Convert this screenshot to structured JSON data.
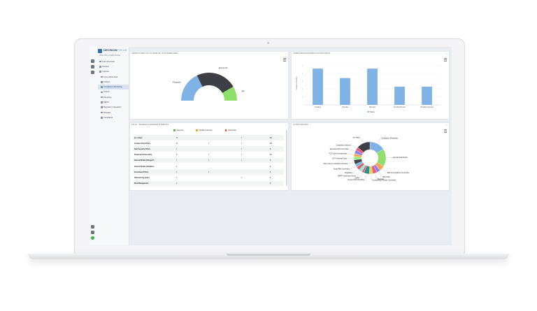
{
  "brand": {
    "name_a": "DECISION",
    "name_b": "FOCUS",
    "subtitle": "RISK AND COMPLIANCE"
  },
  "sidebar": {
    "items": [
      {
        "label": "Team Overview",
        "active": false,
        "sub": false
      },
      {
        "label": "Decision",
        "active": false,
        "sub": false
      },
      {
        "label": "Contract",
        "active": false,
        "sub": false
      },
      {
        "label": "Group Wide Data",
        "active": false,
        "sub": true
      },
      {
        "label": "Policies",
        "active": false,
        "sub": true
      },
      {
        "label": "Compliance Monitoring",
        "active": true,
        "sub": true
      },
      {
        "label": "Actions",
        "active": false,
        "sub": true
      },
      {
        "label": "Reporting",
        "active": false,
        "sub": true
      },
      {
        "label": "MBOS",
        "active": false,
        "sub": true
      },
      {
        "label": "Regulatory Interaction",
        "active": false,
        "sub": true
      },
      {
        "label": "Disputes",
        "active": false,
        "sub": true
      },
      {
        "label": "Complaints",
        "active": false,
        "sub": true
      }
    ]
  },
  "panels": {
    "gauge_title": "CONDUCT RISKS OUT OF APPETITE - BY BUSINESS AREA",
    "bar_title": "COMPLIANCE MONITORING ACTIONS STATUS",
    "table_title": "POLICY - BUSINESS STANDARDS ATTRIBUTES",
    "donut_title": "ACTION TRACKING"
  },
  "chart_data": [
    {
      "type": "pie",
      "subtype": "half-donut",
      "labels": [
        "Financial",
        "Economic",
        "HR"
      ],
      "values": [
        3,
        4,
        1.4
      ],
      "colors": [
        "#7fb2e5",
        "#3d3f45",
        "#8ee06b"
      ]
    },
    {
      "type": "bar",
      "categories": [
        "Pending",
        "Overdue",
        "Planning",
        "Pending Review",
        "Pending Approval"
      ],
      "values": [
        4.6,
        3.4,
        4.6,
        2.3,
        2.3
      ],
      "ylabel": "Number of Actions",
      "legend": "Status",
      "color": "#7fb2e5",
      "ylim": [
        0,
        5.5
      ]
    },
    {
      "type": "pie",
      "subtype": "donut",
      "labels": [
        "Compliance Monitoring",
        "Internal Audit Report",
        "Risk & Compliance Committee",
        "Risk Team",
        "Business",
        "Counterparty Security Committee",
        "Group Audit Committee",
        "GDPR",
        "GDPR Governance forum",
        "Regulatory",
        "Group Risk Committee",
        "Client money oversight committee",
        "SGT Steering Group",
        "FCA Client Questionnaire",
        "Executive Risk Committee",
        "Compliance Advisory",
        "(no value)"
      ],
      "values": [
        14,
        16,
        5,
        3,
        4,
        3,
        5,
        2,
        3,
        3,
        3,
        4,
        3,
        3,
        3,
        3,
        12
      ],
      "colors": [
        "#7fb2e5",
        "#8ee06b",
        "#f7a35c",
        "#8085e9",
        "#f15c80",
        "#e4d354",
        "#2b908f",
        "#f45b5b",
        "#91e8e1",
        "#e45d5d",
        "#7cb5ec",
        "#434348",
        "#90ed7d",
        "#f7a35c",
        "#8085e9",
        "#f15c80",
        "#3d3f45"
      ]
    }
  ],
  "table": {
    "legend": [
      "Adequate",
      "Partially Adequate",
      "Inadequate"
    ],
    "legend_colors": [
      "#5fb84c",
      "#f4a940",
      "#e0523a"
    ],
    "rows": [
      {
        "name": "(no value)",
        "a": "11",
        "p": "",
        "i": "1",
        "t": "12"
      },
      {
        "name": "Conduct Risk Policy",
        "a": "11",
        "p": "1",
        "i": "1",
        "t": "13"
      },
      {
        "name": "Data Security Policy",
        "a": "1",
        "p": "",
        "i": "1",
        "t": "2"
      },
      {
        "name": "Financial Crime policy",
        "a": "9",
        "p": "1",
        "i": "1",
        "t": "11"
      },
      {
        "name": "Internal Model Change P...",
        "a": "1",
        "p": "1",
        "i": "1",
        "t": "3"
      },
      {
        "name": "Internal Model Validation",
        "a": "2",
        "p": "",
        "i": "",
        "t": "2"
      },
      {
        "name": "Investment Policy",
        "a": "1",
        "p": "1",
        "i": "",
        "t": "2"
      },
      {
        "name": "Outsourcing policy",
        "a": "1",
        "p": "",
        "i": "1",
        "t": "2"
      },
      {
        "name": "Risk Management",
        "a": "2",
        "p": "",
        "i": "",
        "t": "2"
      }
    ]
  }
}
